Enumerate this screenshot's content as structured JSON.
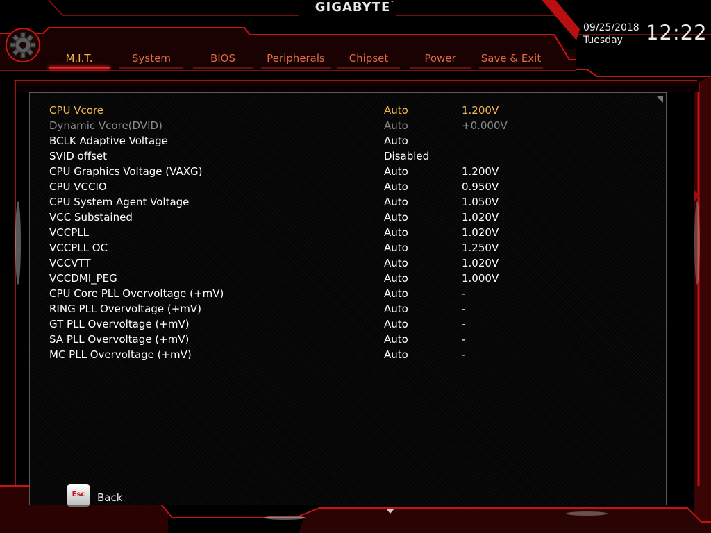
{
  "brand": {
    "name": "GIGABYTE",
    "mark": "™"
  },
  "header": {
    "date": "09/25/2018",
    "day": "Tuesday",
    "time": "12:22"
  },
  "tabs": [
    {
      "label": "M.I.T.",
      "active": true
    },
    {
      "label": "System",
      "active": false
    },
    {
      "label": "BIOS",
      "active": false
    },
    {
      "label": "Peripherals",
      "active": false
    },
    {
      "label": "Chipset",
      "active": false
    },
    {
      "label": "Power",
      "active": false
    },
    {
      "label": "Save & Exit",
      "active": false
    }
  ],
  "settings": [
    {
      "label": "CPU Vcore",
      "value": "Auto",
      "current": "1.200V",
      "state": "selected"
    },
    {
      "label": "Dynamic Vcore(DVID)",
      "value": "Auto",
      "current": "+0.000V",
      "state": "disabled"
    },
    {
      "label": "BCLK Adaptive Voltage",
      "value": "Auto",
      "current": "",
      "state": "normal"
    },
    {
      "label": "SVID offset",
      "value": "Disabled",
      "current": "",
      "state": "normal"
    },
    {
      "label": "CPU Graphics Voltage (VAXG)",
      "value": "Auto",
      "current": "1.200V",
      "state": "normal"
    },
    {
      "label": "CPU VCCIO",
      "value": "Auto",
      "current": "0.950V",
      "state": "normal"
    },
    {
      "label": "CPU System Agent Voltage",
      "value": "Auto",
      "current": "1.050V",
      "state": "normal"
    },
    {
      "label": "VCC Substained",
      "value": "Auto",
      "current": "1.020V",
      "state": "normal"
    },
    {
      "label": "VCCPLL",
      "value": "Auto",
      "current": "1.020V",
      "state": "normal"
    },
    {
      "label": "VCCPLL OC",
      "value": "Auto",
      "current": "1.250V",
      "state": "normal"
    },
    {
      "label": "VCCVTT",
      "value": "Auto",
      "current": "1.020V",
      "state": "normal"
    },
    {
      "label": "VCCDMI_PEG",
      "value": "Auto",
      "current": "1.000V",
      "state": "normal"
    },
    {
      "label": "CPU Core PLL Overvoltage (+mV)",
      "value": "Auto",
      "current": "-",
      "state": "normal"
    },
    {
      "label": "RING PLL Overvoltage (+mV)",
      "value": "Auto",
      "current": "-",
      "state": "normal"
    },
    {
      "label": "GT PLL Overvoltage (+mV)",
      "value": "Auto",
      "current": "-",
      "state": "normal"
    },
    {
      "label": "SA PLL Overvoltage (+mV)",
      "value": "Auto",
      "current": "-",
      "state": "normal"
    },
    {
      "label": "MC PLL Overvoltage (+mV)",
      "value": "Auto",
      "current": "-",
      "state": "normal"
    }
  ],
  "footer": {
    "esc_key": "Esc",
    "back_label": "Back"
  },
  "icons": {
    "gear": "gear-icon",
    "esc": "esc-key-icon"
  },
  "colors": {
    "accent_red": "#d11a1a",
    "tab_text": "#e06a44",
    "selected_text": "#f3b94e",
    "disabled_text": "#8c8c8c"
  }
}
